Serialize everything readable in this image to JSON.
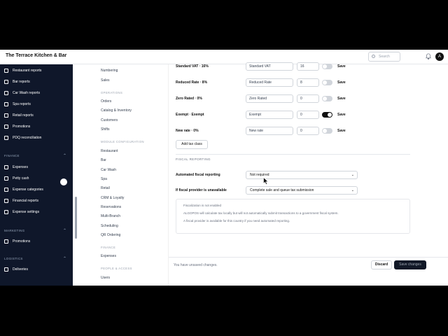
{
  "header": {
    "title": "The Terrace Kitchen & Bar",
    "search_placeholder": "Search",
    "avatar_initial": "A"
  },
  "sidebar": {
    "items_top": [
      {
        "label": "Restaurant reports"
      },
      {
        "label": "Bar reports"
      },
      {
        "label": "Car Wash reports"
      },
      {
        "label": "Spa reports"
      },
      {
        "label": "Retail reports"
      },
      {
        "label": "Promotions"
      },
      {
        "label": "PDQ reconciliation"
      }
    ],
    "finance_label": "FINANCE",
    "finance_items": [
      {
        "label": "Expenses"
      },
      {
        "label": "Petty cash"
      },
      {
        "label": "Expense categories"
      },
      {
        "label": "Financial reports"
      },
      {
        "label": "Expense settings"
      }
    ],
    "marketing_label": "MARKETING",
    "marketing_items": [
      {
        "label": "Promotions"
      }
    ],
    "logistics_label": "LOGISTICS",
    "logistics_items": [
      {
        "label": "Deliveries"
      }
    ]
  },
  "subnav": {
    "top_items": [
      "Numbering",
      "Sales"
    ],
    "operations_label": "OPERATIONS",
    "operations_items": [
      "Orders",
      "Catalog & Inventory",
      "Customers",
      "Shifts"
    ],
    "module_label": "MODULE CONFIGURATION",
    "module_items": [
      "Restaurant",
      "Bar",
      "Car Wash",
      "Spa",
      "Retail",
      "CRM & Loyalty",
      "Reservations",
      "Multi-Branch",
      "Scheduling",
      "QR Ordering"
    ],
    "finance_label": "FINANCE",
    "finance_items": [
      "Expenses"
    ],
    "people_label": "PEOPLE & ACCESS",
    "people_items": [
      "Users"
    ]
  },
  "tax_classes": [
    {
      "label": "Standard VAT · 16%",
      "name": "Standard VAT",
      "rate": "16",
      "enabled": false
    },
    {
      "label": "Reduced Rate · 8%",
      "name": "Reduced Rate",
      "rate": "8",
      "enabled": false
    },
    {
      "label": "Zero Rated · 0%",
      "name": "Zero Rated",
      "rate": "0",
      "enabled": false
    },
    {
      "label": "Exempt · Exempt",
      "name": "Exempt",
      "rate": "0",
      "enabled": true
    },
    {
      "label": "New rate · 0%",
      "name": "New rate",
      "rate": "0",
      "enabled": false
    }
  ],
  "save_label": "Save",
  "add_tax_label": "Add tax class",
  "fiscal": {
    "section_label": "FISCAL REPORTING",
    "automated_label": "Automated fiscal reporting",
    "automated_value": "Not required",
    "unavailable_label": "If fiscal provider is unavailable",
    "unavailable_value": "Complete sale and queue tax submission",
    "note_1": "Fiscalization is not enabled",
    "note_2": "ALGOPOS will calculate tax locally but will not automatically submit transactions to a government fiscal system.",
    "note_3": "A fiscal provider is available for this country if you need automated reporting."
  },
  "footer": {
    "message": "You have unsaved changes.",
    "discard": "Discard",
    "save_changes": "Save changes"
  }
}
